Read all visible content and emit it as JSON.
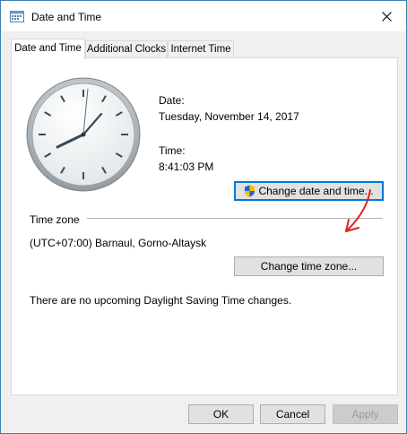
{
  "window": {
    "title": "Date and Time"
  },
  "tabs": [
    {
      "label": "Date and Time",
      "active": true
    },
    {
      "label": "Additional Clocks",
      "active": false
    },
    {
      "label": "Internet Time",
      "active": false
    }
  ],
  "datetime": {
    "date_label": "Date:",
    "date_value": "Tuesday, November 14, 2017",
    "time_label": "Time:",
    "time_value": "8:41:03 PM",
    "change_button": "Change date and time..."
  },
  "timezone": {
    "section_label": "Time zone",
    "value": "(UTC+07:00) Barnaul, Gorno-Altaysk",
    "change_button": "Change time zone...",
    "dst_message": "There are no upcoming Daylight Saving Time changes."
  },
  "footer": {
    "ok_label": "OK",
    "cancel_label": "Cancel",
    "apply_label": "Apply"
  },
  "colors": {
    "accent": "#0078d7",
    "annotation_arrow": "#e0201c"
  },
  "icons": {
    "title": "calendar-clock-icon",
    "close": "close-icon",
    "uac": "uac-shield-icon"
  }
}
